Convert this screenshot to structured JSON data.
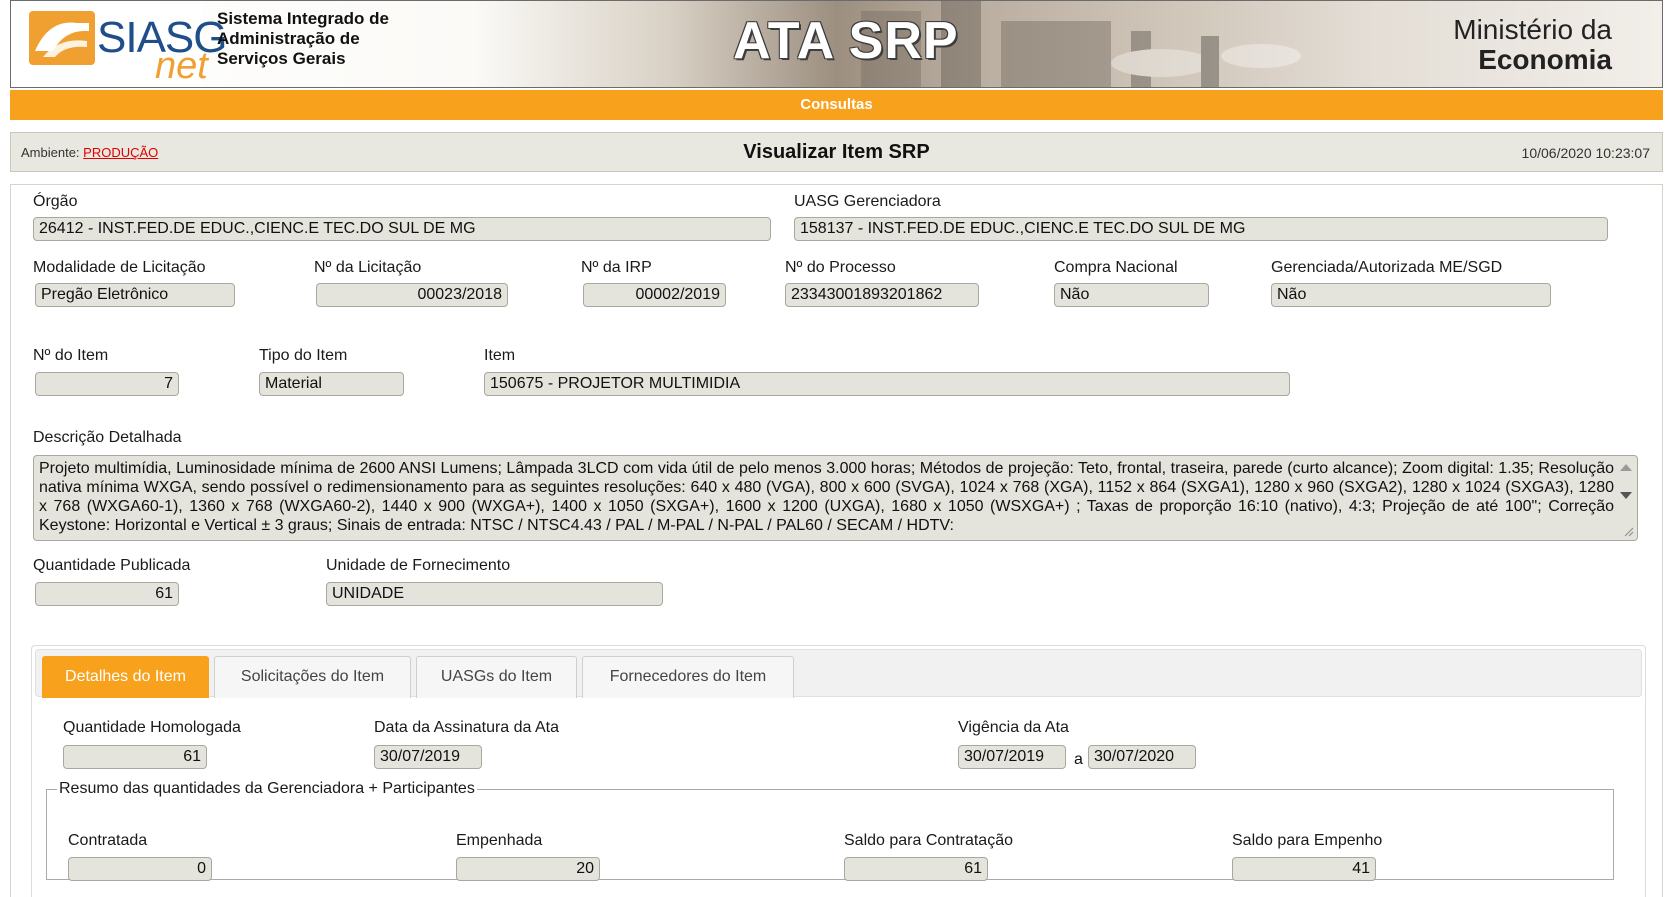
{
  "header": {
    "logo_text": "SIASG",
    "logo_subtext": "net",
    "system_name_lines": [
      "Sistema Integrado de",
      "Administração de",
      "Serviços Gerais"
    ],
    "banner_title": "ATA SRP",
    "ministry_line1": "Ministério da",
    "ministry_line2": "Economia"
  },
  "menu": {
    "label": "Consultas"
  },
  "titlebar": {
    "ambiente_label": "Ambiente:",
    "ambiente_value": "PRODUÇÃO",
    "page_title": "Visualizar Item SRP",
    "datetime": "10/06/2020 10:23:07"
  },
  "form": {
    "orgao": {
      "label": "Órgão",
      "value": "26412 - INST.FED.DE EDUC.,CIENC.E TEC.DO SUL DE MG"
    },
    "uasg": {
      "label": "UASG Gerenciadora",
      "value": "158137 - INST.FED.DE EDUC.,CIENC.E TEC.DO SUL DE MG"
    },
    "modalidade": {
      "label": "Modalidade de Licitação",
      "value": "Pregão Eletrônico"
    },
    "licitacao": {
      "label": "Nº da Licitação",
      "value": "00023/2018"
    },
    "irp": {
      "label": "Nº da IRP",
      "value": "00002/2019"
    },
    "processo": {
      "label": "Nº do Processo",
      "value": "23343001893201862"
    },
    "compra_nacional": {
      "label": "Compra Nacional",
      "value": "Não"
    },
    "gerenciada": {
      "label": "Gerenciada/Autorizada ME/SGD",
      "value": "Não"
    },
    "num_item": {
      "label": "Nº do Item",
      "value": "7"
    },
    "tipo_item": {
      "label": "Tipo do Item",
      "value": "Material"
    },
    "item": {
      "label": "Item",
      "value": "150675 - PROJETOR MULTIMIDIA"
    },
    "descricao": {
      "label": "Descrição Detalhada",
      "value": "Projeto multimídia, Luminosidade mínima de 2600 ANSI Lumens; Lâmpada 3LCD com vida útil de pelo menos 3.000 horas; Métodos de projeção: Teto, frontal, traseira, parede (curto alcance); Zoom digital: 1.35; Resolução nativa mínima WXGA, sendo possível o redimensionamento para as seguintes resoluções: 640 x 480 (VGA), 800 x 600 (SVGA), 1024 x 768 (XGA), 1152 x 864 (SXGA1), 1280 x 960 (SXGA2), 1280 x 1024 (SXGA3), 1280 x 768 (WXGA60-1), 1360 x 768 (WXGA60-2), 1440 x 900 (WXGA+), 1400 x 1050 (SXGA+), 1600 x 1200 (UXGA), 1680 x 1050 (WSXGA+) ; Taxas de proporção 16:10 (nativo), 4:3; Projeção de até 100\"; Correção Keystone: Horizontal e Vertical ± 3 graus; Sinais de entrada: NTSC / NTSC4.43 / PAL / M-PAL / N-PAL / PAL60 / SECAM / HDTV:"
    },
    "qtd_publicada": {
      "label": "Quantidade Publicada",
      "value": "61"
    },
    "unidade": {
      "label": "Unidade de Fornecimento",
      "value": "UNIDADE"
    }
  },
  "tabs": [
    {
      "label": "Detalhes do Item",
      "active": true
    },
    {
      "label": "Solicitações do Item",
      "active": false
    },
    {
      "label": "UASGs do Item",
      "active": false
    },
    {
      "label": "Fornecedores do Item",
      "active": false
    }
  ],
  "details": {
    "qtd_homologada": {
      "label": "Quantidade Homologada",
      "value": "61"
    },
    "data_assinatura": {
      "label": "Data da Assinatura da Ata",
      "value": "30/07/2019"
    },
    "vigencia": {
      "label": "Vigência da Ata",
      "from": "30/07/2019",
      "sep": "a",
      "to": "30/07/2020"
    },
    "resumo": {
      "legend": "Resumo das quantidades da Gerenciadora + Participantes",
      "contratada": {
        "label": "Contratada",
        "value": "0"
      },
      "empenhada": {
        "label": "Empenhada",
        "value": "20"
      },
      "saldo_contratacao": {
        "label": "Saldo para Contratação",
        "value": "61"
      },
      "saldo_empenho": {
        "label": "Saldo para Empenho",
        "value": "41"
      }
    }
  },
  "colors": {
    "accent": "#f7a11d",
    "field_bg": "#e4e3dc",
    "ambiente_link": "#e00000"
  }
}
